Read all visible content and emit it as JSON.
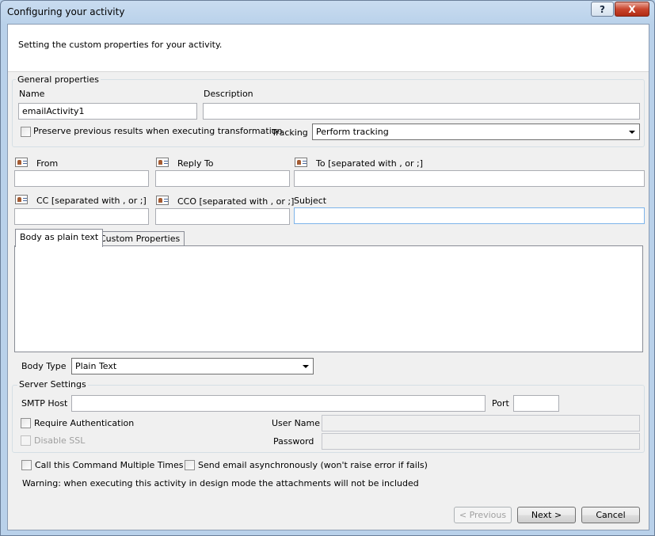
{
  "window": {
    "title": "Configuring your activity",
    "help_label": "?",
    "close_label": "X"
  },
  "header": {
    "description": "Setting the custom properties for your activity."
  },
  "general": {
    "group_title": "General properties",
    "name_label": "Name",
    "name_value": "emailActivity1",
    "description_label": "Description",
    "description_value": "",
    "preserve_label": "Preserve previous results when executing transformation",
    "preserve_checked": false,
    "tracking_label": "Tracking",
    "tracking_value": "Perform tracking"
  },
  "addresses": {
    "from_label": "From",
    "reply_to_label": "Reply To",
    "to_label": "To [separated with , or ;]",
    "cc_label": "CC [separated with , or ;]",
    "cco_label": "CCO [separated with , or ;]",
    "subject_label": "Subject",
    "from_value": "",
    "reply_to_value": "",
    "to_value": "",
    "cc_value": "",
    "cco_value": "",
    "subject_value": ""
  },
  "tabs": [
    {
      "label": "Body as plain text",
      "active": true
    },
    {
      "label": "Custom Properties",
      "active": false
    }
  ],
  "body_type": {
    "label": "Body Type",
    "value": "Plain Text"
  },
  "server": {
    "group_title": "Server Settings",
    "smtp_label": "SMTP Host",
    "smtp_value": "",
    "port_label": "Port",
    "port_value": "",
    "require_auth_label": "Require Authentication",
    "disable_ssl_label": "Disable SSL",
    "username_label": "User Name",
    "password_label": "Password"
  },
  "options": {
    "multiple_label": "Call this Command Multiple Times",
    "async_label": "Send email asynchronously (won't raise error if fails)",
    "warning": "Warning: when executing this activity in design mode the attachments will not be included"
  },
  "buttons": {
    "previous": "< Previous",
    "next": "Next >",
    "cancel": "Cancel"
  },
  "icons": {
    "address_book": "address-book-icon",
    "dropdown": "chevron-down-icon"
  }
}
